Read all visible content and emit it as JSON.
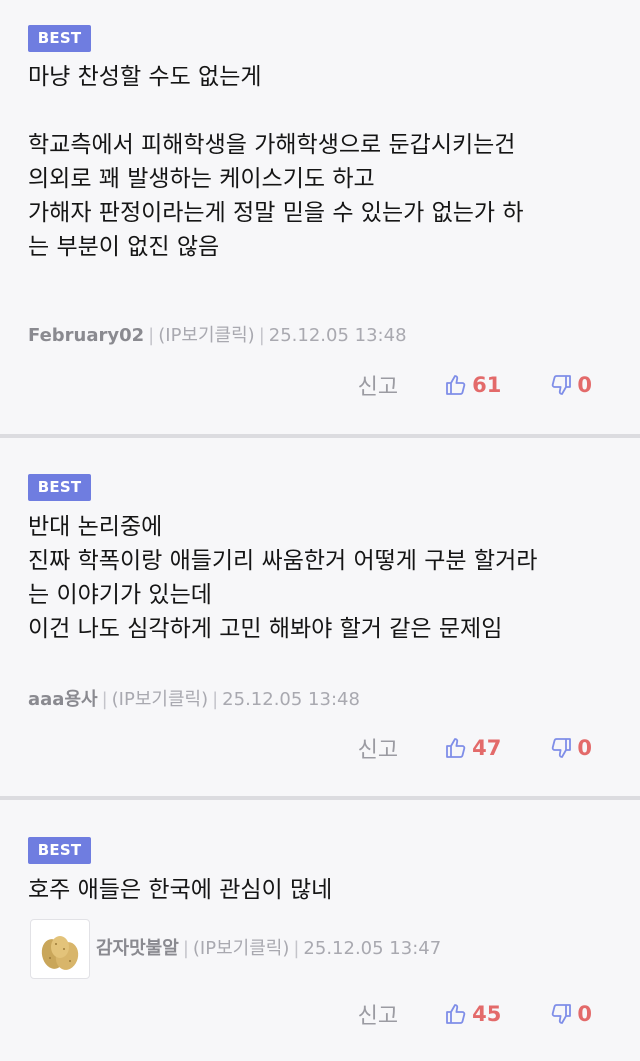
{
  "comments": [
    {
      "badge": "BEST",
      "body": "마냥 찬성할 수도 없는게\n\n학교측에서 피해학생을 가해학생으로 둔갑시키는건\n의외로 꽤 발생하는 케이스기도 하고\n가해자 판정이라는게 정말 믿을 수 있는가 없는가 하\n는 부분이 없진 않음",
      "author": "February02",
      "ip_link": "(IP보기클릭)",
      "timestamp": "25.12.05 13:48",
      "report_label": "신고",
      "likes": "61",
      "dislikes": "0"
    },
    {
      "badge": "BEST",
      "body": "반대 논리중에\n진짜 학폭이랑 애들기리 싸움한거 어떻게 구분 할거라\n는 이야기가 있는데\n이건 나도 심각하게 고민 해봐야 할거 같은 문제임",
      "author": "aaa용사",
      "ip_link": "(IP보기클릭)",
      "timestamp": "25.12.05 13:48",
      "report_label": "신고",
      "likes": "47",
      "dislikes": "0"
    },
    {
      "badge": "BEST",
      "body": "호주 애들은 한국에 관심이 많네",
      "author": "감자맛불알",
      "ip_link": "(IP보기클릭)",
      "timestamp": "25.12.05 13:47",
      "report_label": "신고",
      "likes": "45",
      "dislikes": "0"
    }
  ],
  "colors": {
    "badge_bg": "#6f7de0",
    "like_icon": "#7f8ee8",
    "count_red": "#e36a6a",
    "separator": "#dcdce0"
  },
  "icons": {
    "like": "thumbs-up-icon",
    "dislike": "thumbs-down-icon",
    "avatar": "potato-avatar-icon"
  }
}
